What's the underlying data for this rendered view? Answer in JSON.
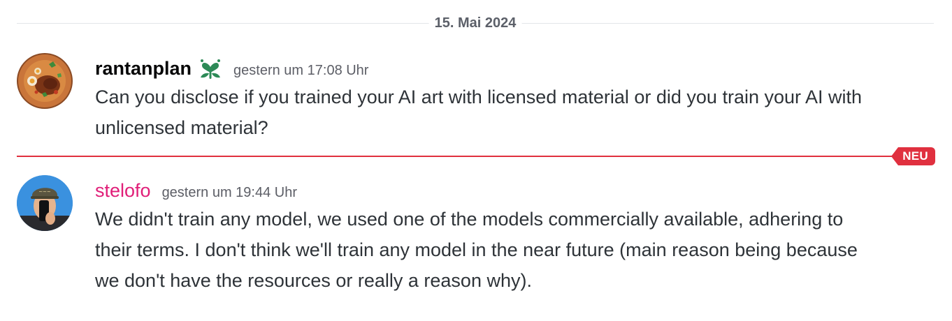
{
  "date_divider": {
    "label": "15. Mai 2024"
  },
  "messages": [
    {
      "username": "rantanplan",
      "username_color": "#060607",
      "role_icon": "green-heart-leaf-icon",
      "timestamp": "gestern um 17:08 Uhr",
      "text": "Can you disclose if you trained your AI art with licensed material or did you train your AI with unlicensed material?",
      "avatar": "food-bowl-avatar"
    },
    {
      "username": "stelofo",
      "username_color": "#e01e78",
      "timestamp": "gestern um 19:44 Uhr",
      "text": "We didn't train any model, we used one of the models commercially available, adhering to their terms. I don't think we'll train any model in the near future (main reason being because we don't have the resources or really a reason why).",
      "avatar": "person-selfie-avatar"
    }
  ],
  "new_divider": {
    "label": "NEU",
    "color": "#e0303f"
  },
  "colors": {
    "accent_green": "#2d8a57",
    "new_red": "#e0303f"
  }
}
